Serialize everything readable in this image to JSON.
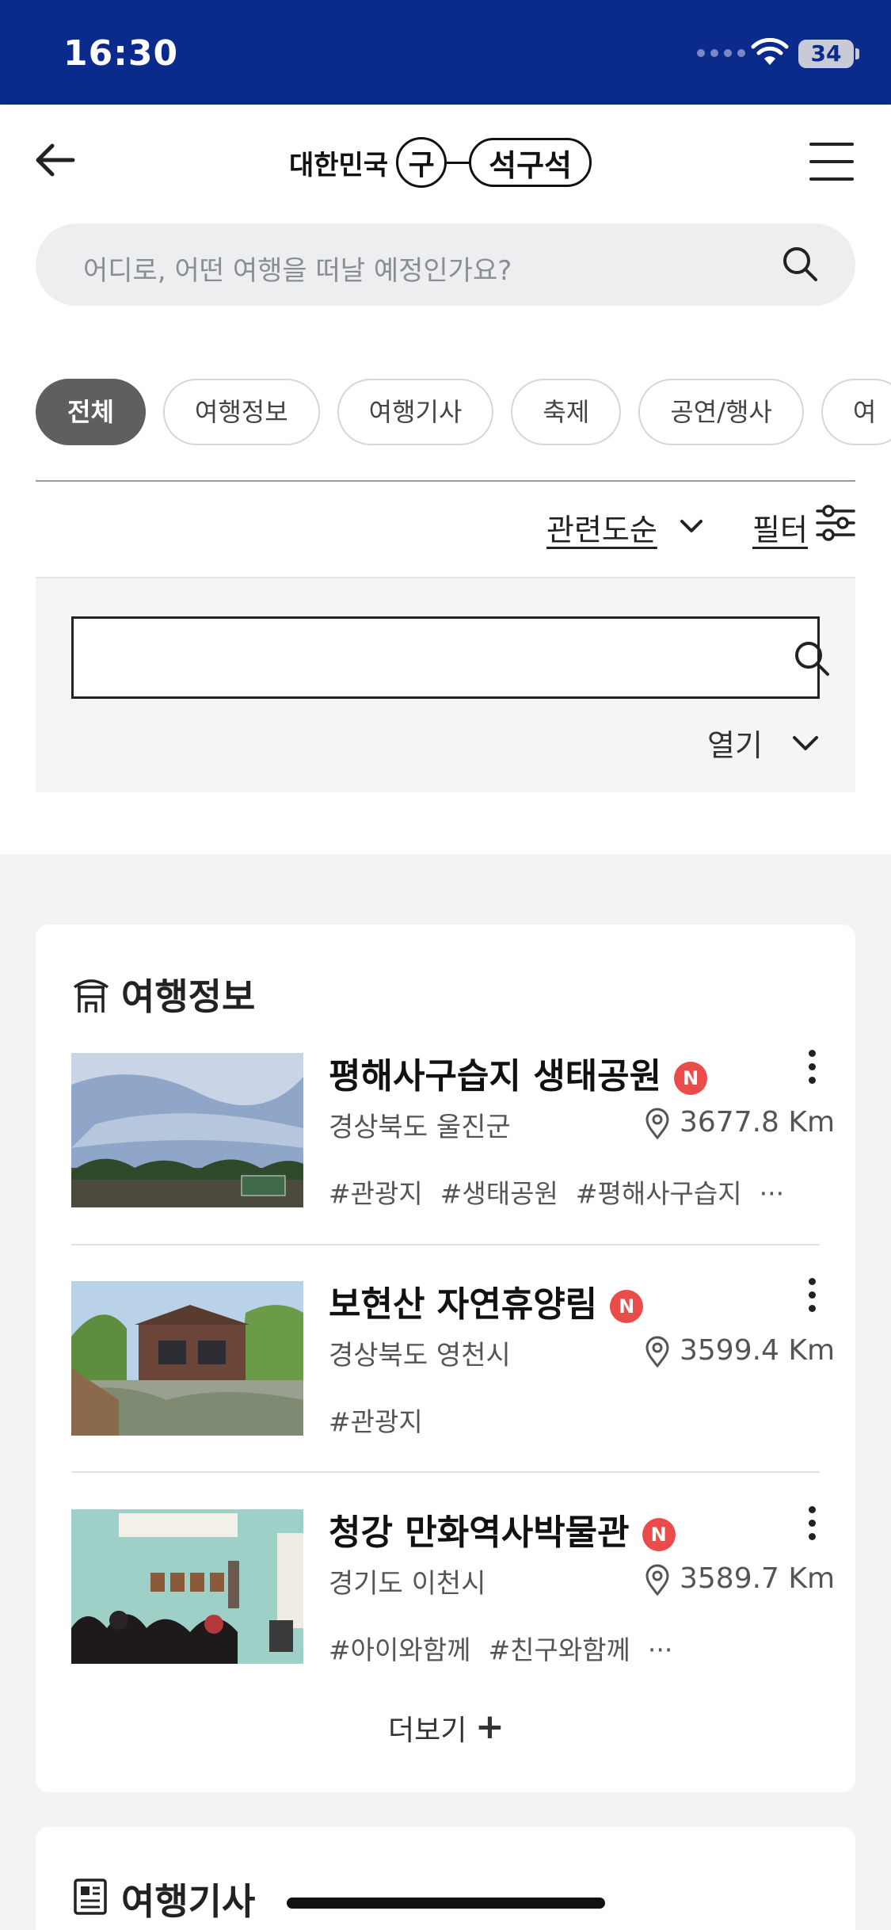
{
  "status_bar": {
    "time": "16:30",
    "battery": "34"
  },
  "header": {
    "logo_text": "대한민국",
    "logo_circle": "구",
    "logo_pill": "석구석",
    "search_placeholder": "어디로, 어떤 여행을 떠날 예정인가요?"
  },
  "filters": {
    "chips": [
      "전체",
      "여행정보",
      "여행기사",
      "축제",
      "공연/행사",
      "여"
    ],
    "sort_label": "관련도순",
    "filter_label": "필터",
    "open_label": "열기"
  },
  "travel_info": {
    "title": "여행정보",
    "items": [
      {
        "title": "평해사구습지 생태공원",
        "badge": "N",
        "region": "경상북도 울진군",
        "distance": "3677.8 Km",
        "tags": [
          "#관광지",
          "#생태공원",
          "#평해사구습지",
          "···"
        ]
      },
      {
        "title": "보현산 자연휴양림",
        "badge": "N",
        "region": "경상북도 영천시",
        "distance": "3599.4 Km",
        "tags": [
          "#관광지"
        ]
      },
      {
        "title": "청강 만화역사박물관",
        "badge": "N",
        "region": "경기도 이천시",
        "distance": "3589.7 Km",
        "tags": [
          "#아이와함께",
          "#친구와함께",
          "···"
        ]
      }
    ],
    "more_label": "더보기",
    "more_symbol": "+"
  },
  "travel_articles": {
    "title": "여행기사"
  },
  "colors": {
    "status_bar": "#0a2a8c",
    "badge": "#ea4c4c",
    "active_chip": "#5f5f5f"
  }
}
